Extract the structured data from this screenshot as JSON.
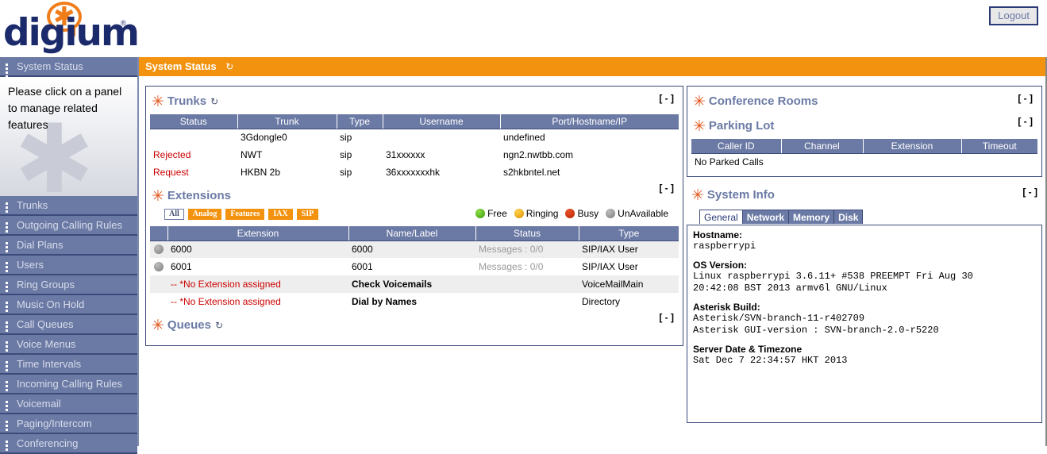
{
  "brand": {
    "name": "digium",
    "registered": "®",
    "asterisk": "✱"
  },
  "header": {
    "logout_label": "Logout"
  },
  "page": {
    "title": "System Status",
    "refresh_icon": "↻"
  },
  "sidebar": {
    "active_item": "System Status",
    "note": "Please click on a panel to manage related features",
    "items": [
      {
        "label": "Trunks"
      },
      {
        "label": "Outgoing Calling Rules"
      },
      {
        "label": "Dial Plans"
      },
      {
        "label": "Users"
      },
      {
        "label": "Ring Groups"
      },
      {
        "label": "Music On Hold"
      },
      {
        "label": "Call Queues"
      },
      {
        "label": "Voice Menus"
      },
      {
        "label": "Time Intervals"
      },
      {
        "label": "Incoming Calling Rules"
      },
      {
        "label": "Voicemail"
      },
      {
        "label": "Paging/Intercom"
      },
      {
        "label": "Conferencing"
      }
    ]
  },
  "trunks": {
    "title": "Trunks",
    "refresh_icon": "↻",
    "collapse": "[ - ]",
    "columns": [
      "Status",
      "Trunk",
      "Type",
      "Username",
      "Port/Hostname/IP"
    ],
    "rows": [
      {
        "status": "",
        "trunk": "3Gdongle0",
        "type": "sip",
        "username": "",
        "host": "undefined"
      },
      {
        "status": "Rejected",
        "trunk": "NWT",
        "type": "sip",
        "username": "31xxxxxx",
        "host": "ngn2.nwtbb.com"
      },
      {
        "status": "Request",
        "trunk": "HKBN 2b",
        "type": "sip",
        "username": "36xxxxxxxhk",
        "host": "s2hkbntel.net"
      }
    ]
  },
  "extensions": {
    "title": "Extensions",
    "collapse": "[ - ]",
    "filters": [
      {
        "label": "All",
        "selected": true
      },
      {
        "label": "Analog",
        "selected": false
      },
      {
        "label": "Features",
        "selected": false
      },
      {
        "label": "IAX",
        "selected": false
      },
      {
        "label": "SIP",
        "selected": false
      }
    ],
    "legend": [
      {
        "label": "Free",
        "color": "#4caf1a"
      },
      {
        "label": "Ringing",
        "color": "#e8a317"
      },
      {
        "label": "Busy",
        "color": "#c63000"
      },
      {
        "label": "UnAvailable",
        "color": "#909090"
      }
    ],
    "columns": [
      "",
      "Extension",
      "Name/Label",
      "Status",
      "Type"
    ],
    "rows": [
      {
        "dot": "gray",
        "extension": "6000",
        "name": "6000",
        "status": "Messages : 0/0",
        "type": "SIP/IAX User"
      },
      {
        "dot": "gray",
        "extension": "6001",
        "name": "6001",
        "status": "Messages : 0/0",
        "type": "SIP/IAX User"
      },
      {
        "dot": "",
        "extension": "-- *No Extension assigned",
        "name": "Check Voicemails",
        "status": "",
        "type": "VoiceMailMain"
      },
      {
        "dot": "",
        "extension": "-- *No Extension assigned",
        "name": "Dial by Names",
        "status": "",
        "type": "Directory"
      }
    ]
  },
  "queues": {
    "title": "Queues",
    "refresh_icon": "↻",
    "collapse": "[ - ]"
  },
  "conference_rooms": {
    "title": "Conference Rooms",
    "collapse": "[ - ]"
  },
  "parking_lot": {
    "title": "Parking Lot",
    "collapse": "[ - ]",
    "columns": [
      "Caller ID",
      "Channel",
      "Extension",
      "Timeout"
    ],
    "empty_message": "No Parked Calls"
  },
  "system_info": {
    "title": "System Info",
    "collapse": "[ - ]",
    "tabs": [
      {
        "label": "General",
        "active": true
      },
      {
        "label": "Network",
        "active": false
      },
      {
        "label": "Memory",
        "active": false
      },
      {
        "label": "Disk",
        "active": false
      }
    ],
    "hostname_label": "Hostname:",
    "hostname_value": "raspberrypi",
    "os_label": "OS Version:",
    "os_value_line1": "Linux raspberrypi 3.6.11+ #538 PREEMPT Fri Aug 30",
    "os_value_line2": "20:42:08 BST 2013 armv6l GNU/Linux",
    "build_label": "Asterisk Build:",
    "build_value_line1": "Asterisk/SVN-branch-11-r402709",
    "build_value_line2": "Asterisk GUI-version : SVN-branch-2.0-r5220",
    "date_label": "Server Date & Timezone",
    "date_value": "Sat Dec 7 22:34:57 HKT 2013"
  }
}
